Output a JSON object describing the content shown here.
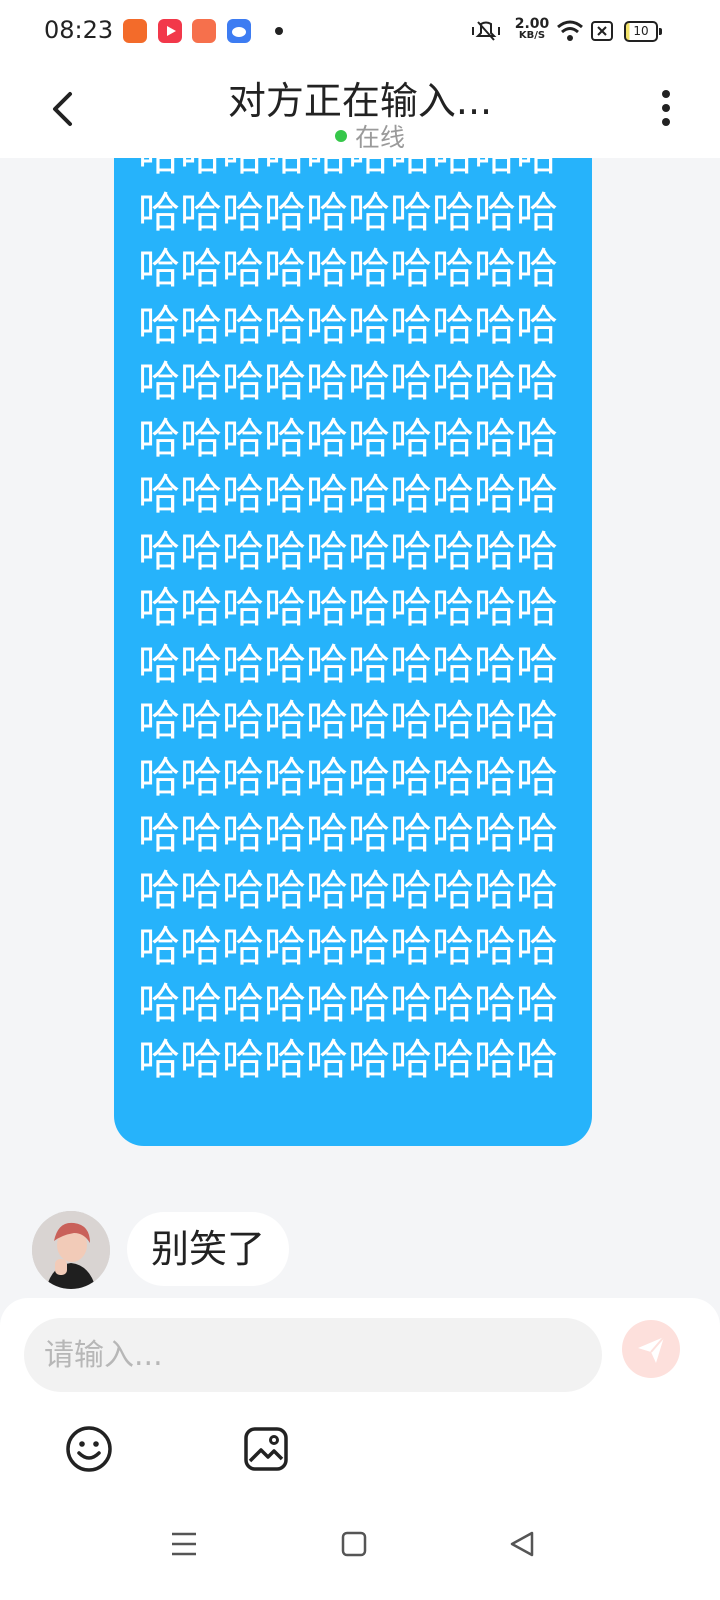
{
  "status_bar": {
    "time": "08:23",
    "app_icons": [
      {
        "name": "app-icon-orange",
        "color": "#f36b2a"
      },
      {
        "name": "app-icon-red-play",
        "color": "#f2384a"
      },
      {
        "name": "app-icon-orange-2",
        "color": "#f6704c"
      },
      {
        "name": "app-icon-blue",
        "color": "#3d7cf2"
      }
    ],
    "net_speed_value": "2.00",
    "net_speed_unit": "KB/S",
    "battery_level": "10"
  },
  "header": {
    "title": "对方正在输入...",
    "presence": "在线",
    "presence_color": "#36c74a"
  },
  "messages": {
    "sent_text": "哈哈哈哈哈哈哈哈哈哈哈哈哈哈哈哈哈哈哈哈哈哈哈哈哈哈哈哈哈哈哈哈哈哈哈哈哈哈哈哈哈哈哈哈哈哈哈哈哈哈哈哈哈哈哈哈哈哈哈哈哈哈哈哈哈哈哈哈哈哈哈哈哈哈哈哈哈哈哈哈哈哈哈哈哈哈哈哈哈哈哈哈哈哈哈哈哈哈哈哈哈哈哈哈哈哈哈哈哈哈哈哈哈哈哈哈哈哈哈哈哈哈哈哈哈哈哈哈哈哈哈哈哈哈哈哈哈哈哈哈哈哈哈哈哈哈哈哈哈哈哈哈哈哈哈哈哈哈哈哈哈哈哈哈哈哈哈哈哈哈",
    "sent_bubble_color": "#26b3fb",
    "received_text": "别笑了"
  },
  "composer": {
    "placeholder": "请输入...",
    "send_icon": "send-icon",
    "tools": [
      "emoji-icon",
      "image-icon"
    ]
  },
  "nav_bar": {
    "buttons": [
      "menu-icon",
      "home-icon",
      "back-triangle-icon"
    ]
  }
}
